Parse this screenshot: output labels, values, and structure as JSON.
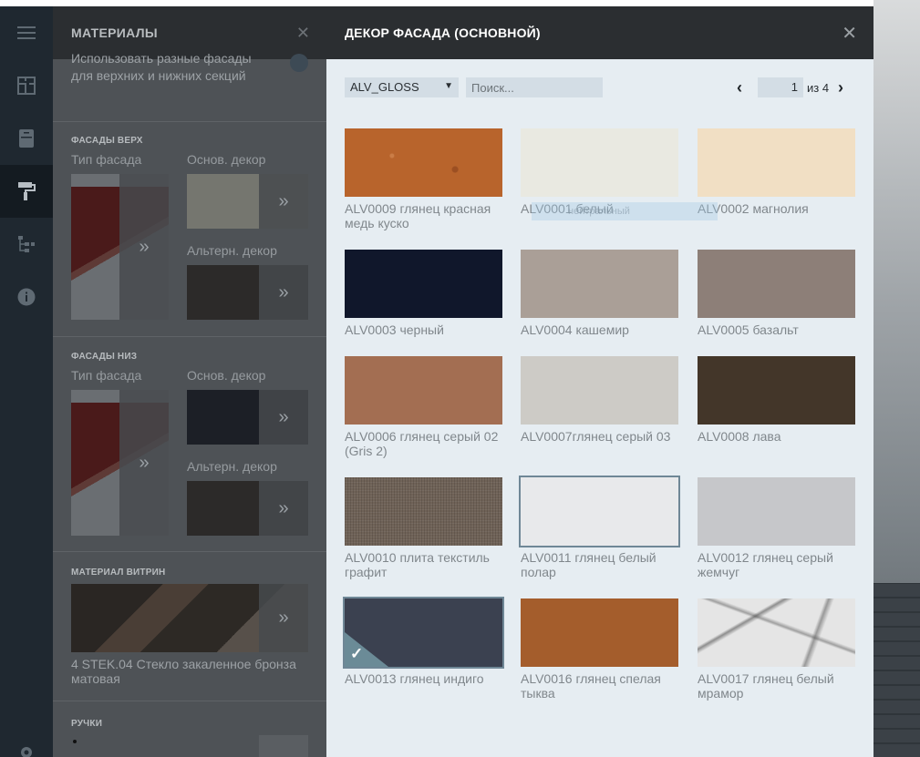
{
  "materials_panel": {
    "title": "МАТЕРИАЛЫ",
    "intro_text": "Использовать разные фасады для верхних и нижних секций",
    "sections": {
      "upper": {
        "label": "ФАСАДЫ ВЕРХ",
        "type_label": "Тип фасада",
        "main_decor_label": "Основ. декор",
        "alt_decor_label": "Альтерн. декор"
      },
      "lower": {
        "label": "ФАСАДЫ НИЗ",
        "type_label": "Тип фасада",
        "main_decor_label": "Основ. декор",
        "alt_decor_label": "Альтерн. декор"
      },
      "showcase": {
        "label": "МАТЕРИАЛ ВИТРИН",
        "value": "4 STEK.04 Стекло закаленное бронза матовая"
      },
      "handles": {
        "label": "РУЧКИ"
      }
    }
  },
  "dialog": {
    "title": "ДЕКОР ФАСАДА (ОСНОВНОЙ)",
    "collection_select": "ALV_GLOSS",
    "search_placeholder": "Поиск...",
    "page_current": "1",
    "page_total_text": "из 4"
  },
  "decors": [
    {
      "label": "ALV0009 глянец красная медь куско",
      "color": "#b8642c"
    },
    {
      "label": "ALV0001 белый",
      "color": "#e9e9e1"
    },
    {
      "label": "ALV0002 магнолия",
      "color": "#f1dfc4"
    },
    {
      "label": "ALV0003 черный",
      "color": "#10172b"
    },
    {
      "label": "ALV0004 кашемир",
      "color": "#aa9f97"
    },
    {
      "label": "ALV0005 базальт",
      "color": "#8d7f78"
    },
    {
      "label": "ALV0006 глянец серый 02 (Gris 2)",
      "color": "#a36e52"
    },
    {
      "label": "ALV0007глянец серый 03",
      "color": "#cdcbc6"
    },
    {
      "label": "ALV0008 лава",
      "color": "#433629"
    },
    {
      "label": "ALV0010 плита текстиль графит",
      "color": "#6f6257"
    },
    {
      "label": "ALV0011 глянец белый полар",
      "color": "#e8e9eb"
    },
    {
      "label": "ALV0012 глянец серый жемчуг",
      "color": "#c6c7ca"
    },
    {
      "label": "ALV0013 глянец индиго",
      "color": "#3b4150"
    },
    {
      "label": "ALV0016 глянец спелая тыква",
      "color": "#a45d2c"
    },
    {
      "label": "ALV0017 глянец белый мрамор",
      "color": "#e5e5e5"
    }
  ],
  "selected_decor": "ALV0013 глянец индиго",
  "ghost_tooltip": "нейтральный"
}
